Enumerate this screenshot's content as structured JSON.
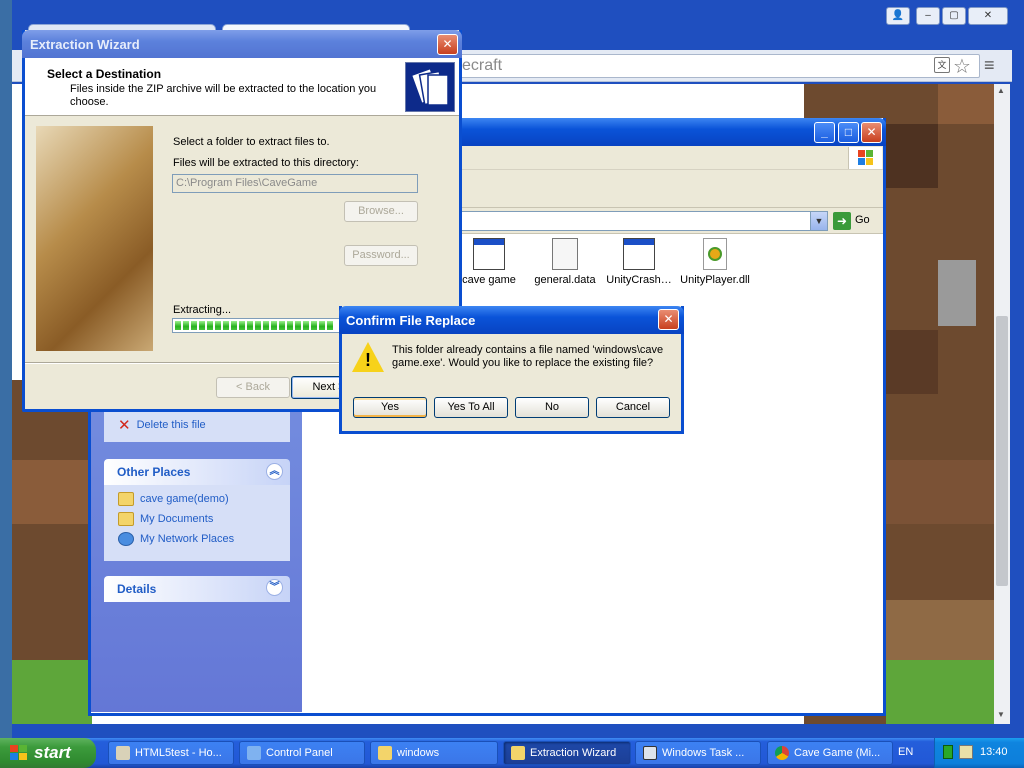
{
  "browser": {
    "omnibox_text": "ecraft",
    "controls": [
      "👤",
      "–",
      "▢",
      "✕"
    ]
  },
  "explorer": {
    "address_go": "Go",
    "task_pane": {
      "delete_link": "Delete this file",
      "other_places": {
        "header": "Other Places",
        "links": [
          "cave game(demo)",
          "My Documents",
          "My Network Places"
        ]
      },
      "details": {
        "header": "Details"
      }
    },
    "files": [
      {
        "name": "cave game",
        "icon": "window-icon"
      },
      {
        "name": "general.data",
        "icon": "data-file-icon"
      },
      {
        "name": "UnityCrash…",
        "icon": "window-icon"
      },
      {
        "name": "UnityPlayer.dll",
        "icon": "dll-gear-icon"
      }
    ]
  },
  "wizard": {
    "title": "Extraction Wizard",
    "header_title": "Select a Destination",
    "header_subtitle": "Files inside the ZIP archive will be extracted to the location you choose.",
    "select_label": "Select a folder to extract files to.",
    "dir_label": "Files will be extracted to this directory:",
    "dir_value": "C:\\Program Files\\CaveGame",
    "browse_label": "Browse...",
    "password_label": "Password...",
    "extracting_label": "Extracting...",
    "progress_percent": 100,
    "back_label": "< Back",
    "next_label": "Next >"
  },
  "confirm": {
    "title": "Confirm File Replace",
    "message": "This folder already contains a file named 'windows\\cave game.exe'.  Would you like to replace the existing file?",
    "buttons": {
      "yes": "Yes",
      "yes_all": "Yes To All",
      "no": "No",
      "cancel": "Cancel"
    }
  },
  "taskbar": {
    "start_label": "start",
    "items": [
      {
        "label": "HTML5test - Ho...",
        "active": false
      },
      {
        "label": "Control Panel",
        "active": false
      },
      {
        "label": "windows",
        "active": false
      },
      {
        "label": "Extraction Wizard",
        "active": true
      },
      {
        "label": "Windows Task ...",
        "active": false
      },
      {
        "label": "Cave Game (Mi...",
        "active": false
      }
    ],
    "language": "EN",
    "clock": "13:40"
  },
  "colors": {
    "xp_blue": "#0a4ed0",
    "taskbar_blue": "#245edb",
    "start_green": "#3c9b3c",
    "link_blue": "#215dc6"
  }
}
